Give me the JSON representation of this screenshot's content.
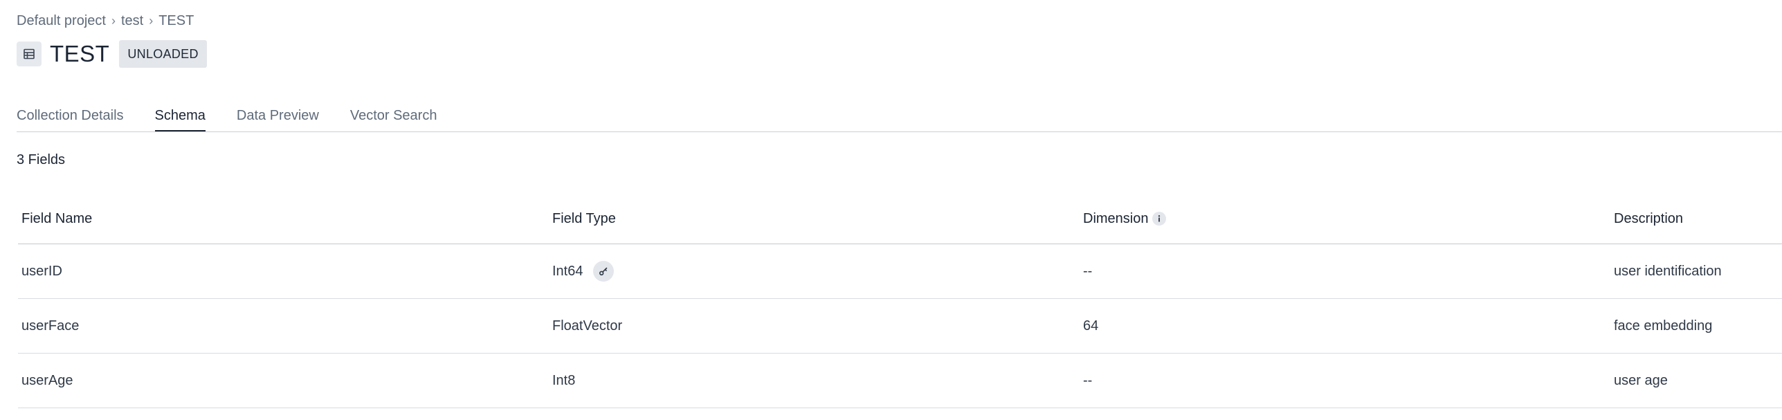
{
  "breadcrumb": {
    "items": [
      "Default project",
      "test",
      "TEST"
    ],
    "separator": "›"
  },
  "collection": {
    "title": "TEST",
    "status": "UNLOADED",
    "icon": "table-icon"
  },
  "tabs": [
    {
      "label": "Collection Details",
      "active": false
    },
    {
      "label": "Schema",
      "active": true
    },
    {
      "label": "Data Preview",
      "active": false
    },
    {
      "label": "Vector Search",
      "active": false
    }
  ],
  "schema": {
    "field_count": "3 Fields",
    "columns": {
      "name": "Field Name",
      "type": "Field Type",
      "dimension": "Dimension",
      "description": "Description"
    },
    "rows": [
      {
        "name": "userID",
        "type": "Int64",
        "primary_key": true,
        "dimension": "--",
        "description": "user identification"
      },
      {
        "name": "userFace",
        "type": "FloatVector",
        "primary_key": false,
        "dimension": "64",
        "description": "face embedding"
      },
      {
        "name": "userAge",
        "type": "Int8",
        "primary_key": false,
        "dimension": "--",
        "description": "user age"
      }
    ]
  },
  "icons": {
    "dimension_info": "info-icon",
    "primary_key": "key-icon"
  },
  "colors": {
    "text_primary": "#1b2433",
    "text_secondary": "#5f6b7a",
    "badge_bg": "#e3e6eb",
    "divider": "#d7dce2"
  }
}
